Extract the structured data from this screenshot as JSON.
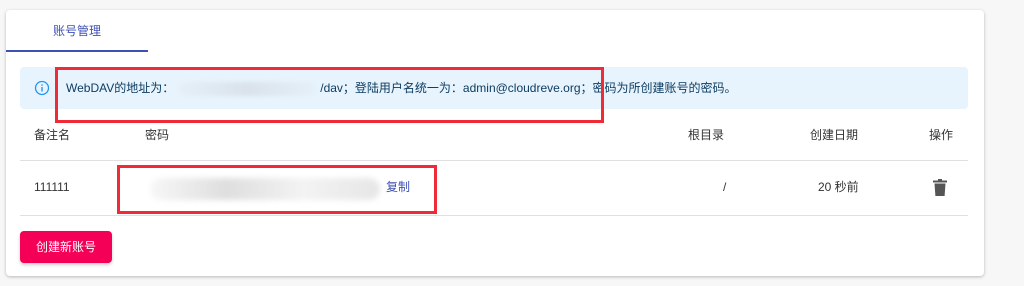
{
  "tabs": [
    {
      "label": "账号管理",
      "active": true
    }
  ],
  "alert": {
    "prefix": "WebDAV的地址为：",
    "suffix": "/dav；登陆用户名统一为：admin@cloudreve.org；密码为所创建账号的密码。"
  },
  "table": {
    "headers": [
      "备注名",
      "密码",
      "根目录",
      "创建日期",
      "操作"
    ],
    "rows": [
      {
        "name": "111111",
        "copy_label": "复制",
        "root": "/",
        "created": "20 秒前"
      }
    ]
  },
  "create_button": "创建新账号",
  "colors": {
    "primary": "#3f51b5",
    "secondary": "#f50057",
    "highlight": "#ee2b36",
    "info_bg": "#e8f4fd"
  },
  "icons": {
    "alert": "info-icon",
    "delete": "trash-icon"
  }
}
